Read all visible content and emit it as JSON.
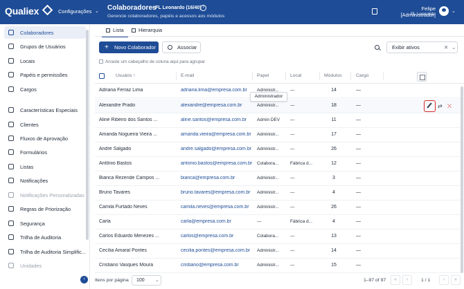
{
  "header": {
    "brand": "Qualiex",
    "config_menu": "Configurações",
    "title": "Colaboradores",
    "subtitle": "- FL Leonardo (16/40)",
    "description": "Gerencie colaboradores, papéis e acessos aos módulos",
    "user_name": "Felipe [Administrador]",
    "user_org": "FL Leonardo"
  },
  "sidebar": {
    "items": [
      {
        "label": "Colaboradores",
        "icon": "users-icon",
        "active": true
      },
      {
        "label": "Grupos de Usuários",
        "icon": "group-icon"
      },
      {
        "label": "Locais",
        "icon": "location-pin-icon"
      },
      {
        "label": "Papéis e permissões",
        "icon": "shield-icon"
      },
      {
        "label": "Cargos",
        "icon": "briefcase-icon"
      },
      {
        "label": "Características Especiais",
        "icon": "star-icon"
      },
      {
        "label": "Clientes",
        "icon": "building-icon"
      },
      {
        "label": "Fluxos de Aprovação",
        "icon": "flow-icon"
      },
      {
        "label": "Formulários",
        "icon": "form-icon"
      },
      {
        "label": "Listas",
        "icon": "list-icon"
      },
      {
        "label": "Notificações",
        "icon": "bell-icon"
      },
      {
        "label": "Notificações Personalizadas",
        "icon": "bell-settings-icon",
        "muted": true
      },
      {
        "label": "Regras de Priorização",
        "icon": "priority-icon"
      },
      {
        "label": "Segurança",
        "icon": "lock-icon"
      },
      {
        "label": "Trilha de Auditoria",
        "icon": "audit-icon"
      },
      {
        "label": "Trilha de Auditoria Simplific...",
        "icon": "audit-simple-icon"
      },
      {
        "label": "Unidades",
        "icon": "unit-icon",
        "muted": true
      }
    ]
  },
  "tabs": [
    {
      "label": "Lista",
      "active": true
    },
    {
      "label": "Hierarquia"
    }
  ],
  "toolbar": {
    "new_label": "Novo Colaborador",
    "associate_label": "Associar",
    "filter_value": "Exibir ativos"
  },
  "group_hint": "Arraste um cabeçalho de coluna aqui para agrupar",
  "table": {
    "columns": [
      "Usuário ↑",
      "E-mail",
      "Papel",
      "Local",
      "Módulos",
      "Cargo"
    ],
    "rows": [
      {
        "name": "Adriana Ferraz Lima",
        "email": "adriana.lima@empresa.com.br",
        "role": "Administr...",
        "local": "—",
        "modules": "14",
        "cargo": "—"
      },
      {
        "name": "Alexandre Prado",
        "email": "alexandre@empresa.com.br",
        "role": "Administr...",
        "local": "—",
        "modules": "18",
        "cargo": "—"
      },
      {
        "name": "Aline Ribeiro dos Santos ...",
        "email": "aline.santos@empresa.com.br",
        "role": "Admin DEV",
        "local": "—",
        "modules": "11",
        "cargo": "—"
      },
      {
        "name": "Amanda Nogueira Vieira ...",
        "email": "amanda.vieira@empresa.com.br",
        "role": "Administr...",
        "local": "—",
        "modules": "17",
        "cargo": "—"
      },
      {
        "name": "André Salgado",
        "email": "andre.salgado@empresa.com.br",
        "role": "Administr...",
        "local": "—",
        "modules": "26",
        "cargo": "—"
      },
      {
        "name": "Antônio Bastos",
        "email": "antonio.bastos@empresa.com.br",
        "role": "Colabora...",
        "local": "Fábrica d...",
        "modules": "12",
        "cargo": "—"
      },
      {
        "name": "Bianca Rezende Campos ...",
        "email": "bianca@empresa.com.br",
        "role": "Administr...",
        "local": "—",
        "modules": "3",
        "cargo": "—"
      },
      {
        "name": "Bruno Tavares",
        "email": "bruno.tavares@empresa.com.br",
        "role": "Administr...",
        "local": "—",
        "modules": "4",
        "cargo": "—"
      },
      {
        "name": "Camila Furtado Neves",
        "email": "camila.neves@empresa.com.br",
        "role": "Administr...",
        "local": "—",
        "modules": "26",
        "cargo": "—"
      },
      {
        "name": "Carla",
        "email": "carla@empresa.com.br",
        "role": "—",
        "local": "Fábrica d...",
        "modules": "4",
        "cargo": "—"
      },
      {
        "name": "Carlos Eduardo Menezes ...",
        "email": "carlos@empresa.com.br",
        "role": "Colabora...",
        "local": "—",
        "modules": "13",
        "cargo": "—"
      },
      {
        "name": "Cecília Amaral Pontes",
        "email": "cecilia.pontes@empresa.com.br",
        "role": "Administr...",
        "local": "—",
        "modules": "14",
        "cargo": "—"
      },
      {
        "name": "Cristiano Vasques Moura",
        "email": "cristiano@empresa.com.br",
        "role": "Administr...",
        "local": "—",
        "modules": "15",
        "cargo": "—"
      }
    ],
    "tooltip": "Administrador"
  },
  "footer": {
    "per_page_label": "Itens por página",
    "per_page_value": "100",
    "range": "1–97 of 97",
    "page": "1 / 1"
  }
}
